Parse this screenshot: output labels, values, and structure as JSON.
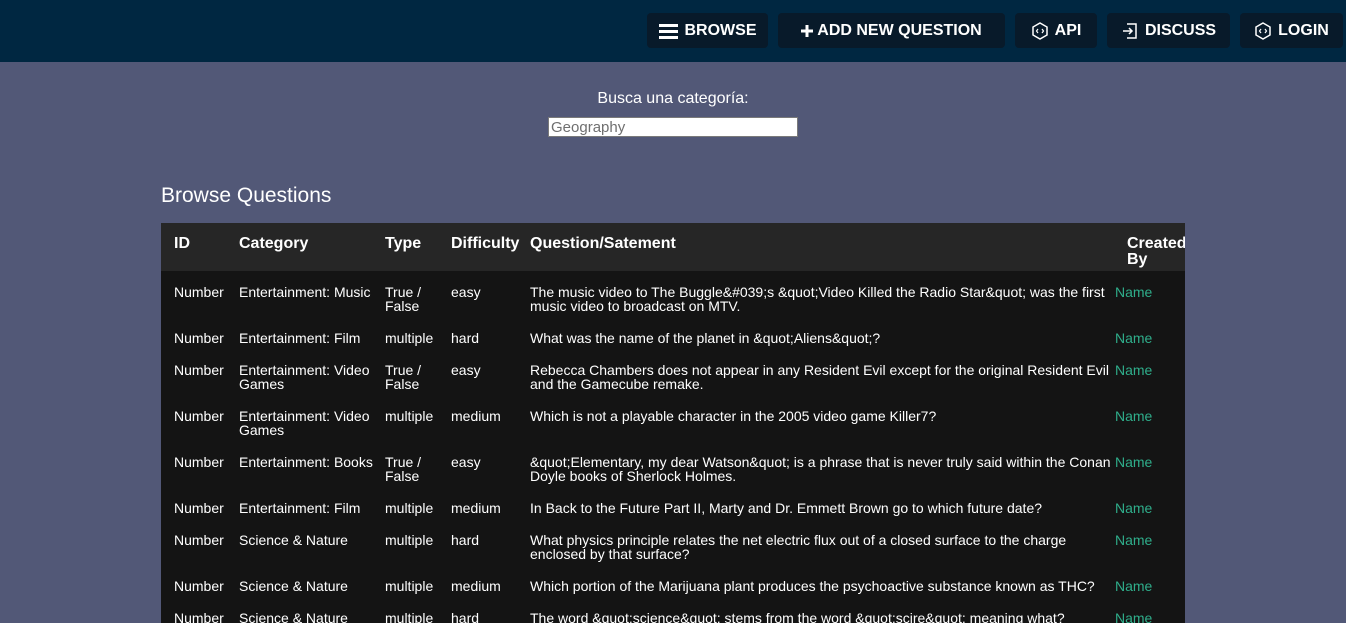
{
  "nav": {
    "browse": "BROWSE",
    "add_question": "ADD NEW QUESTION",
    "api": "API",
    "discuss": "DISCUSS",
    "login": "LOGIN"
  },
  "search": {
    "label": "Busca una categoría:",
    "placeholder": "Geography"
  },
  "page_title": "Browse Questions",
  "table": {
    "headers": [
      "ID",
      "Category",
      "Type",
      "Difficulty",
      "Question/Satement",
      "Created By"
    ],
    "rows": [
      {
        "id": "Number",
        "category": "Entertainment: Music",
        "type": "True / False",
        "difficulty": "easy",
        "question": "The music video to The Buggle&#039;s &quot;Video Killed the Radio Star&quot; was the first music video to broadcast on MTV.",
        "created_by": "Name"
      },
      {
        "id": "Number",
        "category": "Entertainment: Film",
        "type": "multiple",
        "difficulty": "hard",
        "question": "What was the name of the planet in &quot;Aliens&quot;?",
        "created_by": "Name"
      },
      {
        "id": "Number",
        "category": "Entertainment: Video Games",
        "type": "True / False",
        "difficulty": "easy",
        "question": "Rebecca Chambers does not appear in any Resident Evil except for the original Resident Evil and the Gamecube remake.",
        "created_by": "Name"
      },
      {
        "id": "Number",
        "category": "Entertainment: Video Games",
        "type": "multiple",
        "difficulty": "medium",
        "question": "Which is not a playable character in the 2005 video game Killer7?",
        "created_by": "Name"
      },
      {
        "id": "Number",
        "category": "Entertainment: Books",
        "type": "True / False",
        "difficulty": "easy",
        "question": "&quot;Elementary, my dear Watson&quot; is a phrase that is never truly said within the Conan Doyle books of Sherlock Holmes.",
        "created_by": "Name"
      },
      {
        "id": "Number",
        "category": "Entertainment: Film",
        "type": "multiple",
        "difficulty": "medium",
        "question": "In Back to the Future Part II, Marty and Dr. Emmett Brown go to which future date?",
        "created_by": "Name"
      },
      {
        "id": "Number",
        "category": "Science & Nature",
        "type": "multiple",
        "difficulty": "hard",
        "question": "What physics principle relates the net electric flux out of a closed surface to the charge enclosed by that surface?",
        "created_by": "Name"
      },
      {
        "id": "Number",
        "category": "Science & Nature",
        "type": "multiple",
        "difficulty": "medium",
        "question": "Which portion of the Marijuana plant produces the psychoactive substance known as THC?",
        "created_by": "Name"
      },
      {
        "id": "Number",
        "category": "Science & Nature",
        "type": "multiple",
        "difficulty": "hard",
        "question": "The word &quot;science&quot; stems from the word &quot;scire&quot; meaning what?",
        "created_by": "Name"
      }
    ]
  },
  "colors": {
    "navbar": "#002741",
    "nav_button": "#081a2a",
    "page_background": "#525877",
    "table_background": "#141414",
    "table_header": "#262626",
    "link_green": "#2fae8b"
  }
}
